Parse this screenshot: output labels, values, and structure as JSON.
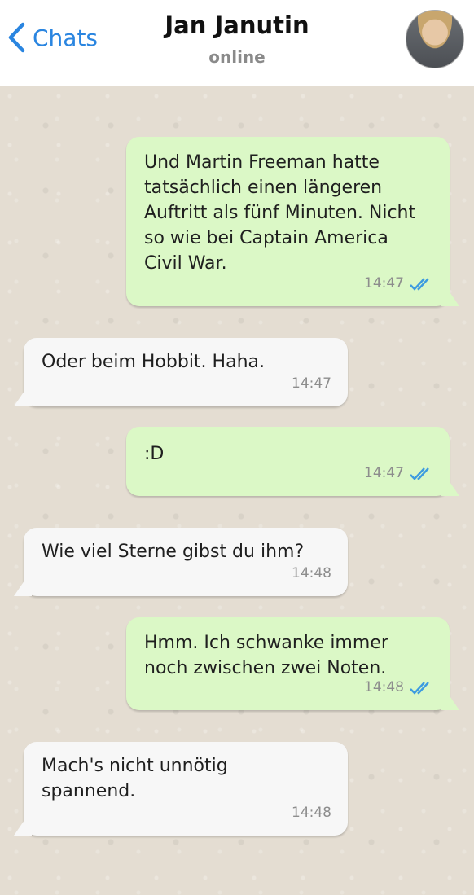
{
  "header": {
    "back_label": "Chats",
    "contact_name": "Jan Janutin",
    "status": "online"
  },
  "colors": {
    "outgoing_bubble": "#dbf8c6",
    "incoming_bubble": "#f7f7f7",
    "link_blue": "#2a85e0",
    "read_ticks": "#3d9be0"
  },
  "messages": [
    {
      "direction": "out",
      "text": "Und Martin Freeman hatte\ntatsächlich einen längeren\nAuftritt als fünf Minuten. Nicht\nso wie bei Captain America\nCivil War.",
      "time": "14:47",
      "read": true
    },
    {
      "direction": "in",
      "text": "Oder beim Hobbit. Haha.",
      "time": "14:47"
    },
    {
      "direction": "out",
      "text": ":D",
      "time": "14:47",
      "read": true
    },
    {
      "direction": "in",
      "text": "Wie viel Sterne gibst du ihm?",
      "time": "14:48"
    },
    {
      "direction": "out",
      "text": "Hmm. Ich schwanke immer\nnoch zwischen zwei Noten.",
      "time": "14:48",
      "read": true
    },
    {
      "direction": "in",
      "text": "Mach's nicht unnötig\nspannend.",
      "time": "14:48"
    }
  ]
}
